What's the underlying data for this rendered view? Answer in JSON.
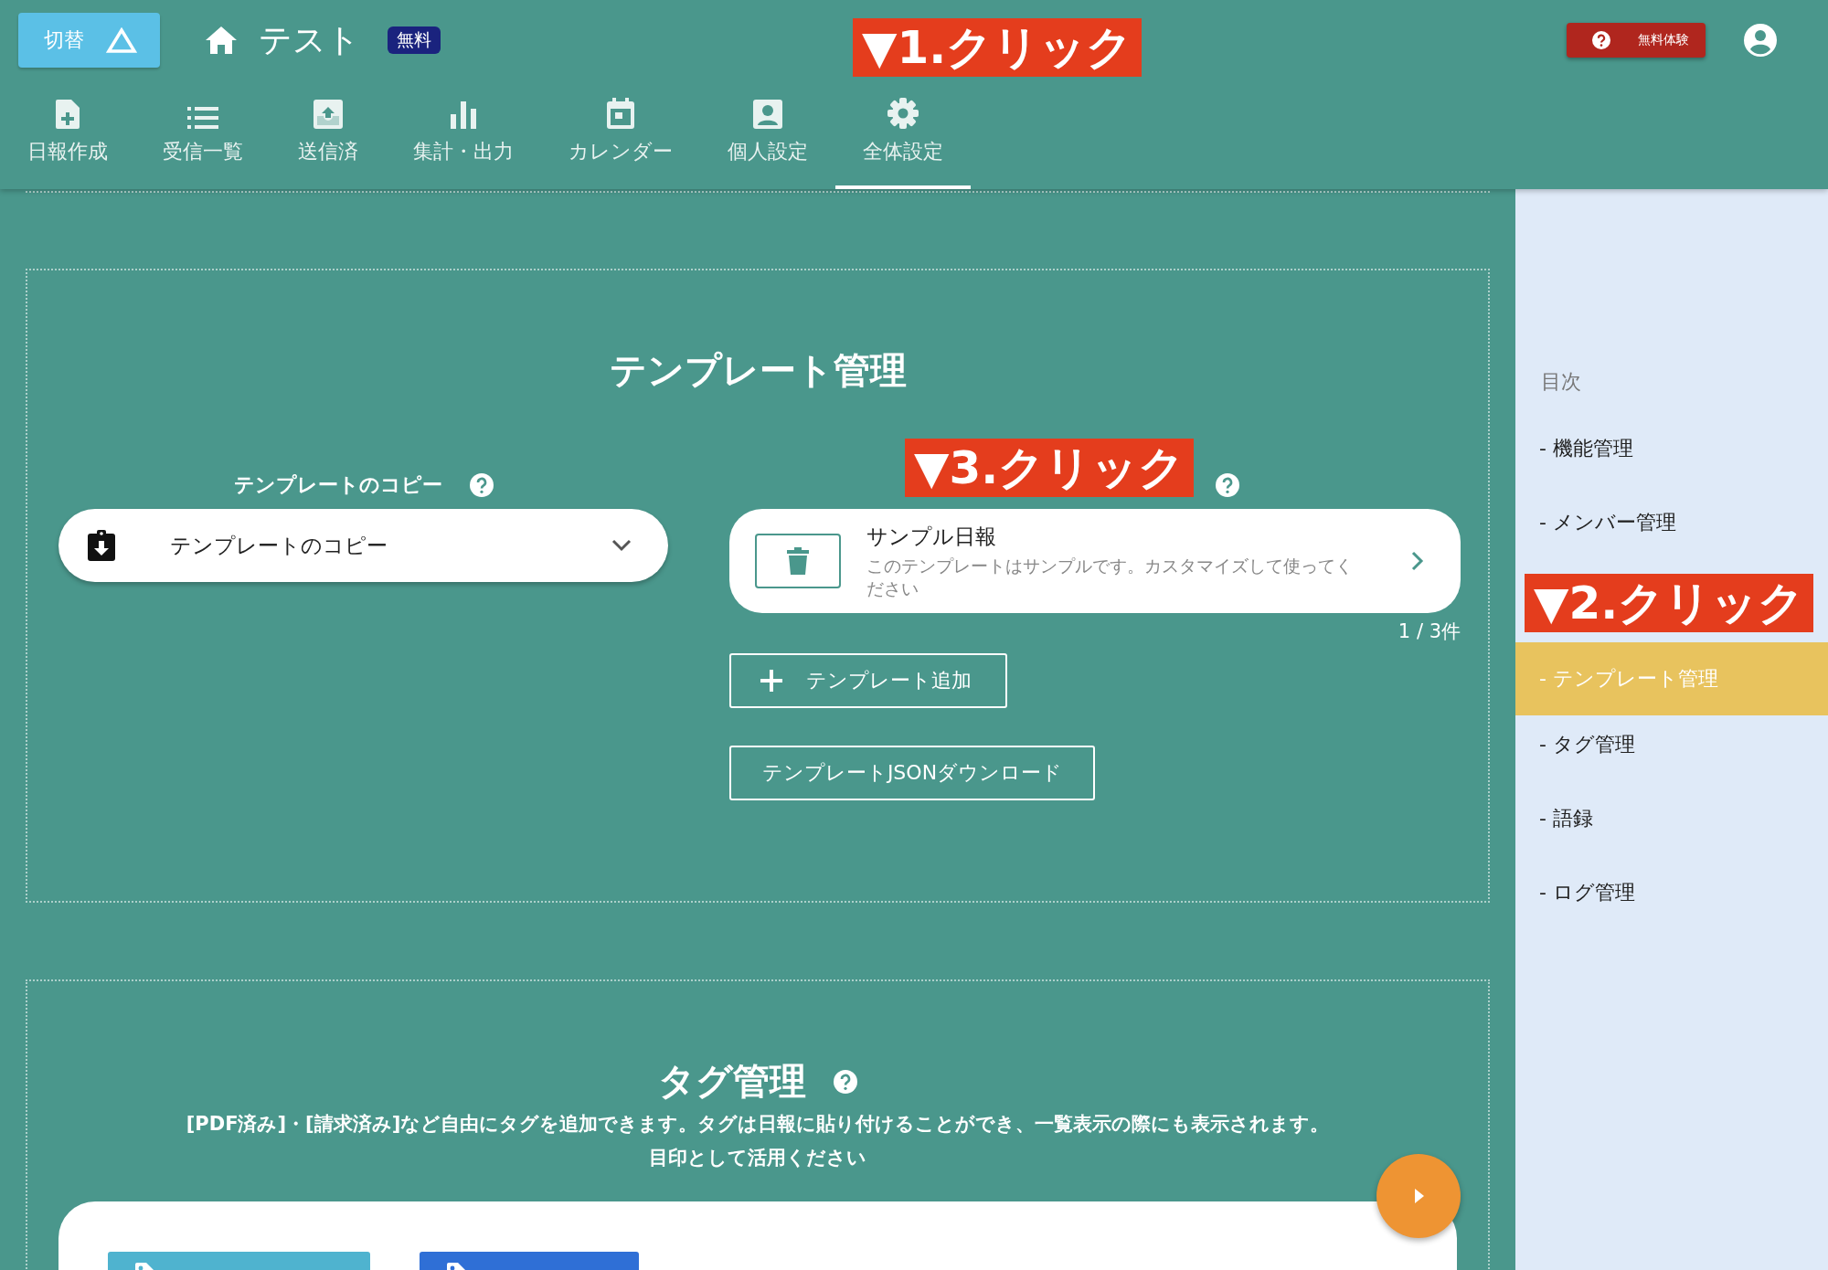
{
  "header": {
    "switch_button": "切替",
    "title": "テスト",
    "plan_badge": "無料",
    "trial_button": "無料体験"
  },
  "nav_tabs": [
    {
      "label": "日報作成",
      "selected": false
    },
    {
      "label": "受信一覧",
      "selected": false
    },
    {
      "label": "送信済",
      "selected": false
    },
    {
      "label": "集計・出力",
      "selected": false
    },
    {
      "label": "カレンダー",
      "selected": false
    },
    {
      "label": "個人設定",
      "selected": false
    },
    {
      "label": "全体設定",
      "selected": true
    }
  ],
  "template_section": {
    "title": "テンプレート管理",
    "copy_label": "テンプレートのコピー",
    "copy_select": "テンプレートのコピー",
    "template_card": {
      "name": "サンプル日報",
      "description": "このテンプレートはサンプルです。カスタマイズして使ってください"
    },
    "count": "1 / 3件",
    "add_button": "テンプレート追加",
    "download_button": "テンプレートJSONダウンロード"
  },
  "tag_section": {
    "title": "タグ管理",
    "description_lines": [
      "[PDF済み]・[請求済み]など自由にタグを追加できます。タグは日報に貼り付けることができ、一覧表示の際にも表示されます。",
      "目印として活用ください"
    ],
    "tags": [
      {
        "color": "#4fb3cf"
      },
      {
        "color": "#2f6fd6"
      }
    ]
  },
  "toc": {
    "title": "目次",
    "items": [
      {
        "label": "- 機能管理",
        "selected": false
      },
      {
        "label": "- メンバー管理",
        "selected": false
      },
      {
        "label": "- テンプレート管理",
        "selected": true
      },
      {
        "label": "- タグ管理",
        "selected": false
      },
      {
        "label": "- 語録",
        "selected": false
      },
      {
        "label": "- ログ管理",
        "selected": false
      }
    ]
  },
  "annotations": [
    "▼1.クリック",
    "▼2.クリック",
    "▼3.クリック"
  ]
}
